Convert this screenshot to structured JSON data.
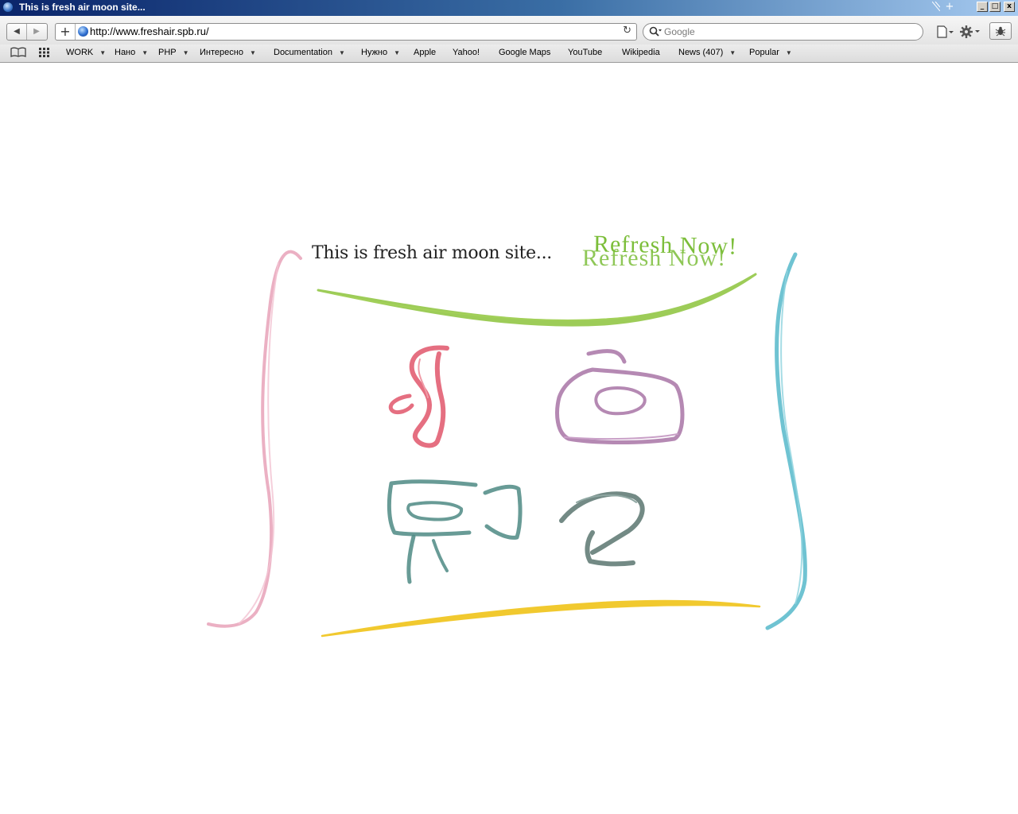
{
  "window": {
    "title": "This is fresh air moon site...",
    "new_tab_glyph": "+",
    "controls": {
      "minimize": "_",
      "maximize": "□",
      "close": "x"
    }
  },
  "navigation": {
    "back_glyph": "◀",
    "forward_glyph": "▶",
    "add_glyph": "+",
    "url": "http://www.freshair.spb.ru/",
    "reload_glyph": "↻",
    "search_placeholder": "Google",
    "search_glyph": "🔍",
    "page_menu_glyph": "▯▾",
    "settings_glyph": "⚙▾",
    "bug_glyph": "✱"
  },
  "bookmarks": {
    "items": [
      {
        "label": "WORK",
        "menu": true
      },
      {
        "label": "Нано",
        "menu": true
      },
      {
        "label": "PHP",
        "menu": true
      },
      {
        "label": "Интересно",
        "menu": true
      },
      {
        "label": "Documentation",
        "menu": true
      },
      {
        "label": "Нужно",
        "menu": true
      },
      {
        "label": "Apple",
        "menu": false
      },
      {
        "label": "Yahoo!",
        "menu": false
      },
      {
        "label": "Google Maps",
        "menu": false
      },
      {
        "label": "YouTube",
        "menu": false
      },
      {
        "label": "Wikipedia",
        "menu": false
      },
      {
        "label": "News (407)",
        "menu": true
      },
      {
        "label": "Popular",
        "menu": true
      }
    ],
    "reading_list_glyph": "📖",
    "top_sites_glyph": "▦"
  },
  "page": {
    "site_title": "This is fresh air moon site...",
    "refresh_label": "Refresh Now!"
  },
  "colors": {
    "green_stroke": "#8cc43c",
    "pink_stroke": "#e9a7bd",
    "cyan_stroke": "#5fbccd",
    "yellow_stroke": "#f0c419",
    "red_icon": "#e0566b",
    "purple_icon": "#a874a6",
    "teal_icon": "#4e8a84",
    "gray_icon": "#5a7570",
    "refresh_green": "#7cbe3a"
  }
}
